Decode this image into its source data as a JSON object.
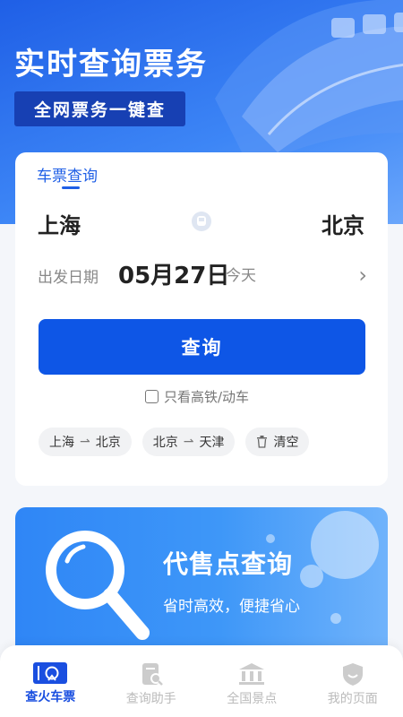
{
  "hero": {
    "title": "实时查询票务",
    "badge": "全网票务一键查"
  },
  "search_card": {
    "tab_label": "车票查询",
    "from_city": "上海",
    "to_city": "北京",
    "date_label": "出发日期",
    "date_value": "05月27日",
    "date_day": "今天",
    "query_button": "查询",
    "high_speed_only": "只看高铁/动车",
    "history": [
      {
        "from": "上海",
        "to": "北京"
      },
      {
        "from": "北京",
        "to": "天津"
      }
    ],
    "clear_label": "清空"
  },
  "banner": {
    "title": "代售点查询",
    "subtitle": "省时高效，便捷省心"
  },
  "tabbar": {
    "items": [
      {
        "label": "查火车票",
        "icon": "ticket-icon",
        "active": true
      },
      {
        "label": "查询助手",
        "icon": "assistant-icon",
        "active": false
      },
      {
        "label": "全国景点",
        "icon": "landmark-icon",
        "active": false
      },
      {
        "label": "我的页面",
        "icon": "profile-icon",
        "active": false
      }
    ]
  },
  "colors": {
    "primary": "#0e56e6",
    "hero_start": "#1f5fe6",
    "banner": "#3e97f8",
    "tab_inactive": "#bbbbbb"
  }
}
